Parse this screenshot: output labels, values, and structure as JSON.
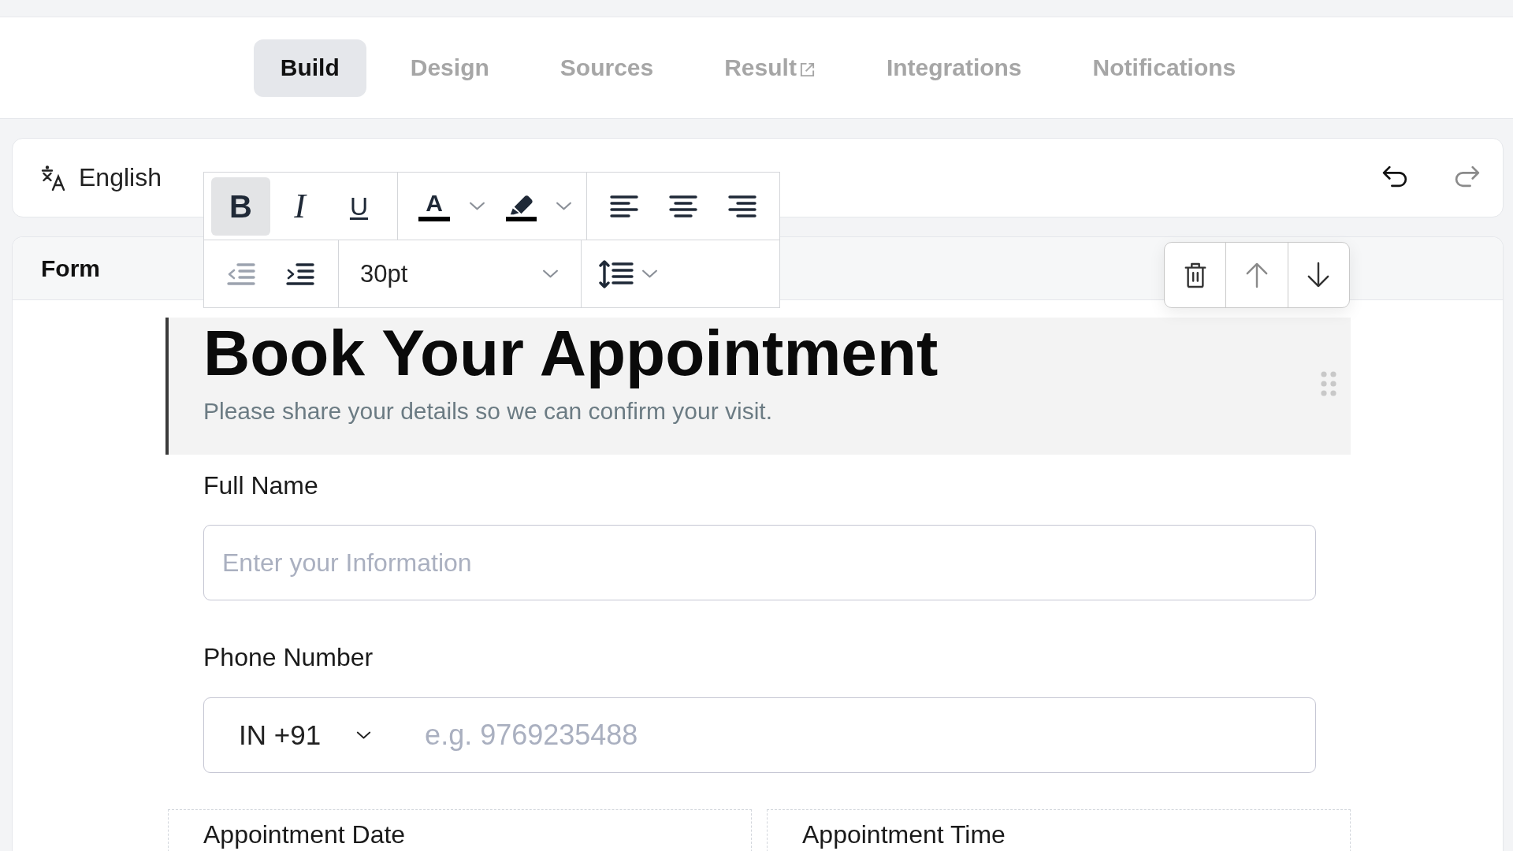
{
  "tabs": [
    {
      "label": "Build",
      "selected": true,
      "external": false
    },
    {
      "label": "Design",
      "selected": false,
      "external": false
    },
    {
      "label": "Sources",
      "selected": false,
      "external": false
    },
    {
      "label": "Result",
      "selected": false,
      "external": true
    },
    {
      "label": "Integrations",
      "selected": false,
      "external": false
    },
    {
      "label": "Notifications",
      "selected": false,
      "external": false
    }
  ],
  "language_bar": {
    "language": "English",
    "history": [
      {
        "kind": "undo",
        "disabled": false
      },
      {
        "kind": "redo",
        "disabled": true
      }
    ]
  },
  "format_toolbar": {
    "styles": [
      {
        "kind": "bold",
        "label": "B",
        "on": true
      },
      {
        "kind": "italic",
        "label": "I",
        "on": false
      },
      {
        "kind": "underline",
        "label": "U",
        "on": false
      }
    ],
    "text_color_label": "A",
    "indent": [
      {
        "kind": "outdent",
        "disabled": true
      },
      {
        "kind": "indent",
        "disabled": false
      }
    ],
    "font_size": "30pt"
  },
  "block_actions": [
    {
      "kind": "delete",
      "disabled": false
    },
    {
      "kind": "move_up",
      "disabled": true
    },
    {
      "kind": "move_down",
      "disabled": false
    }
  ],
  "form": {
    "title": "Form",
    "header": {
      "title": "Book Your Appointment",
      "subtitle": "Please share your details so we can confirm your visit.",
      "selected": true
    },
    "fields": [
      {
        "kind": "text",
        "label": "Full Name",
        "placeholder": "Enter your Information"
      },
      {
        "kind": "phone",
        "label": "Phone Number",
        "country": "IN +91",
        "placeholder": "e.g. 9769235488"
      },
      {
        "kind": "pair",
        "items": [
          {
            "label": "Appointment Date"
          },
          {
            "label": "Appointment Time"
          }
        ]
      }
    ]
  }
}
